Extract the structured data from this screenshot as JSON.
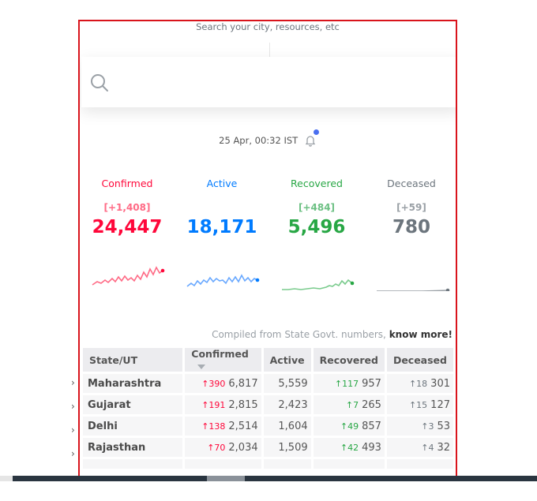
{
  "search": {
    "hint": "Search your city, resources, etc",
    "placeholder": ""
  },
  "timestamp": "25 Apr, 00:32 IST",
  "colors": {
    "confirmed": "#ff073a",
    "active": "#007bff",
    "recovered": "#28a745",
    "deceased": "#6c757d"
  },
  "stats": [
    {
      "label": "Confirmed",
      "delta": "[+1,408]",
      "value": "24,447"
    },
    {
      "label": "Active",
      "delta": "",
      "value": "18,171"
    },
    {
      "label": "Recovered",
      "delta": "[+484]",
      "value": "5,496"
    },
    {
      "label": "Deceased",
      "delta": "[+59]",
      "value": "780"
    }
  ],
  "compiled": {
    "text": "Compiled from State Govt. numbers, ",
    "link": "know more!"
  },
  "table": {
    "headers": [
      "State/UT",
      "Confirmed",
      "Active",
      "Recovered",
      "Deceased"
    ],
    "rows": [
      {
        "state": "Maharashtra",
        "c_delta": "↑390",
        "confirmed": "6,817",
        "active": "5,559",
        "r_delta": "↑117",
        "recovered": "957",
        "d_delta": "↑18",
        "deceased": "301"
      },
      {
        "state": "Gujarat",
        "c_delta": "↑191",
        "confirmed": "2,815",
        "active": "2,423",
        "r_delta": "↑7",
        "recovered": "265",
        "d_delta": "↑15",
        "deceased": "127"
      },
      {
        "state": "Delhi",
        "c_delta": "↑138",
        "confirmed": "2,514",
        "active": "1,604",
        "r_delta": "↑49",
        "recovered": "857",
        "d_delta": "↑3",
        "deceased": "53"
      },
      {
        "state": "Rajasthan",
        "c_delta": "↑70",
        "confirmed": "2,034",
        "active": "1,509",
        "r_delta": "↑42",
        "recovered": "493",
        "d_delta": "↑4",
        "deceased": "32"
      }
    ]
  }
}
